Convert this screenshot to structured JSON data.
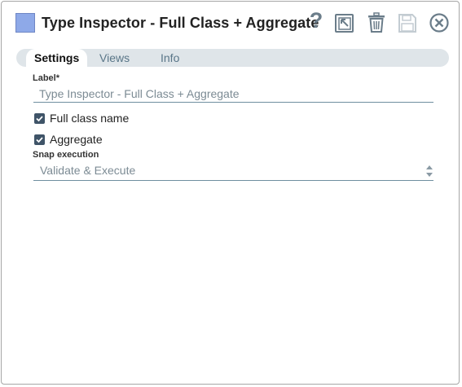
{
  "window": {
    "title": "Type Inspector - Full Class + Aggregate",
    "snap_color": "#8ea9e8",
    "icons": [
      "help-icon",
      "export-icon",
      "delete-icon",
      "save-icon",
      "close-icon"
    ],
    "help_glyph": "?"
  },
  "tabs": [
    {
      "label": "Settings",
      "active": true
    },
    {
      "label": "Views",
      "active": false
    },
    {
      "label": "Info",
      "active": false
    }
  ],
  "settings": {
    "label_field": {
      "label": "Label*",
      "value": "Type Inspector - Full Class + Aggregate"
    },
    "full_class_name": {
      "label": "Full class name",
      "checked": true
    },
    "aggregate": {
      "label": "Aggregate",
      "checked": true
    },
    "snap_execution": {
      "label": "Snap execution",
      "value": "Validate & Execute"
    }
  }
}
